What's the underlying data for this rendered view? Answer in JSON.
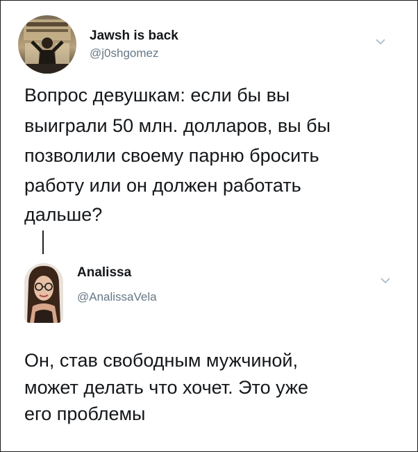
{
  "tweet1": {
    "name": "Jawsh is back",
    "handle": "@j0shgomez",
    "lines": [
      "Вопрос девушкам: если бы вы",
      "выиграли 50 млн. долларов, вы бы",
      "позволили своему парню бросить",
      "работу или он должен работать",
      "дальше?"
    ]
  },
  "tweet2": {
    "name": "Analissa",
    "handle": "@AnalissaVela",
    "lines": [
      "Он, став свободным мужчиной,",
      "может делать что хочет. Это уже",
      "его проблемы"
    ]
  },
  "icons": {
    "menu": "chevron-down-icon",
    "avatar1": "user-avatar-jawsh",
    "avatar2": "user-avatar-analissa"
  },
  "colors": {
    "text": "#14171a",
    "secondary": "#657786",
    "chevron": "#aab8c2",
    "border": "#1a1a1a"
  }
}
